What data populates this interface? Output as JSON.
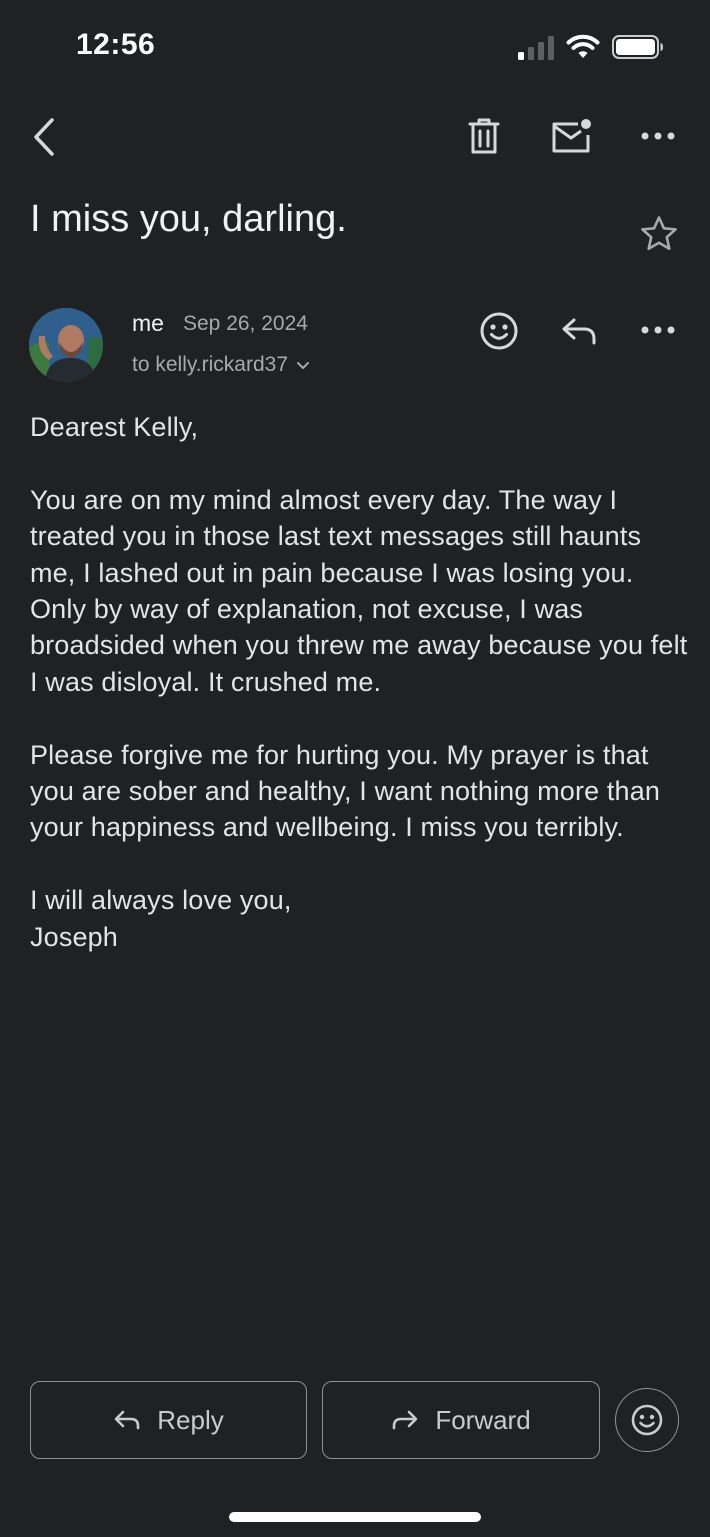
{
  "status_bar": {
    "time": "12:56",
    "signal_icon": "cellular-signal-icon",
    "wifi_icon": "wifi-icon",
    "battery_icon": "battery-icon"
  },
  "toolbar": {
    "back_icon": "chevron-left-icon",
    "delete_icon": "trash-icon",
    "mark_unread_icon": "mail-unread-icon",
    "more_icon": "more-horizontal-icon"
  },
  "email": {
    "subject": "I miss you, darling.",
    "star_icon": "star-outline-icon",
    "sender": "me",
    "date": "Sep 26, 2024",
    "to": "to kelly.rickard37",
    "to_expand_icon": "chevron-down-icon",
    "react_icon": "emoji-icon",
    "reply_icon": "reply-icon",
    "more_icon": "more-horizontal-icon",
    "body": {
      "greeting": "Dearest Kelly,",
      "paragraph_1": "You are on my mind almost every day. The way I treated you in those last text messages still haunts me, I lashed out in pain because I was losing you. Only by way of explanation, not excuse, I was broadsided when you threw me away because you felt I was disloyal. It crushed me.",
      "paragraph_2": "Please forgive me for hurting you. My prayer is that you are sober and healthy, I want nothing more than your happiness and wellbeing. I miss you terribly.",
      "closing": "I will always love you,",
      "signature": "Joseph"
    }
  },
  "actions": {
    "reply_label": "Reply",
    "forward_label": "Forward",
    "emoji_icon": "emoji-icon"
  }
}
